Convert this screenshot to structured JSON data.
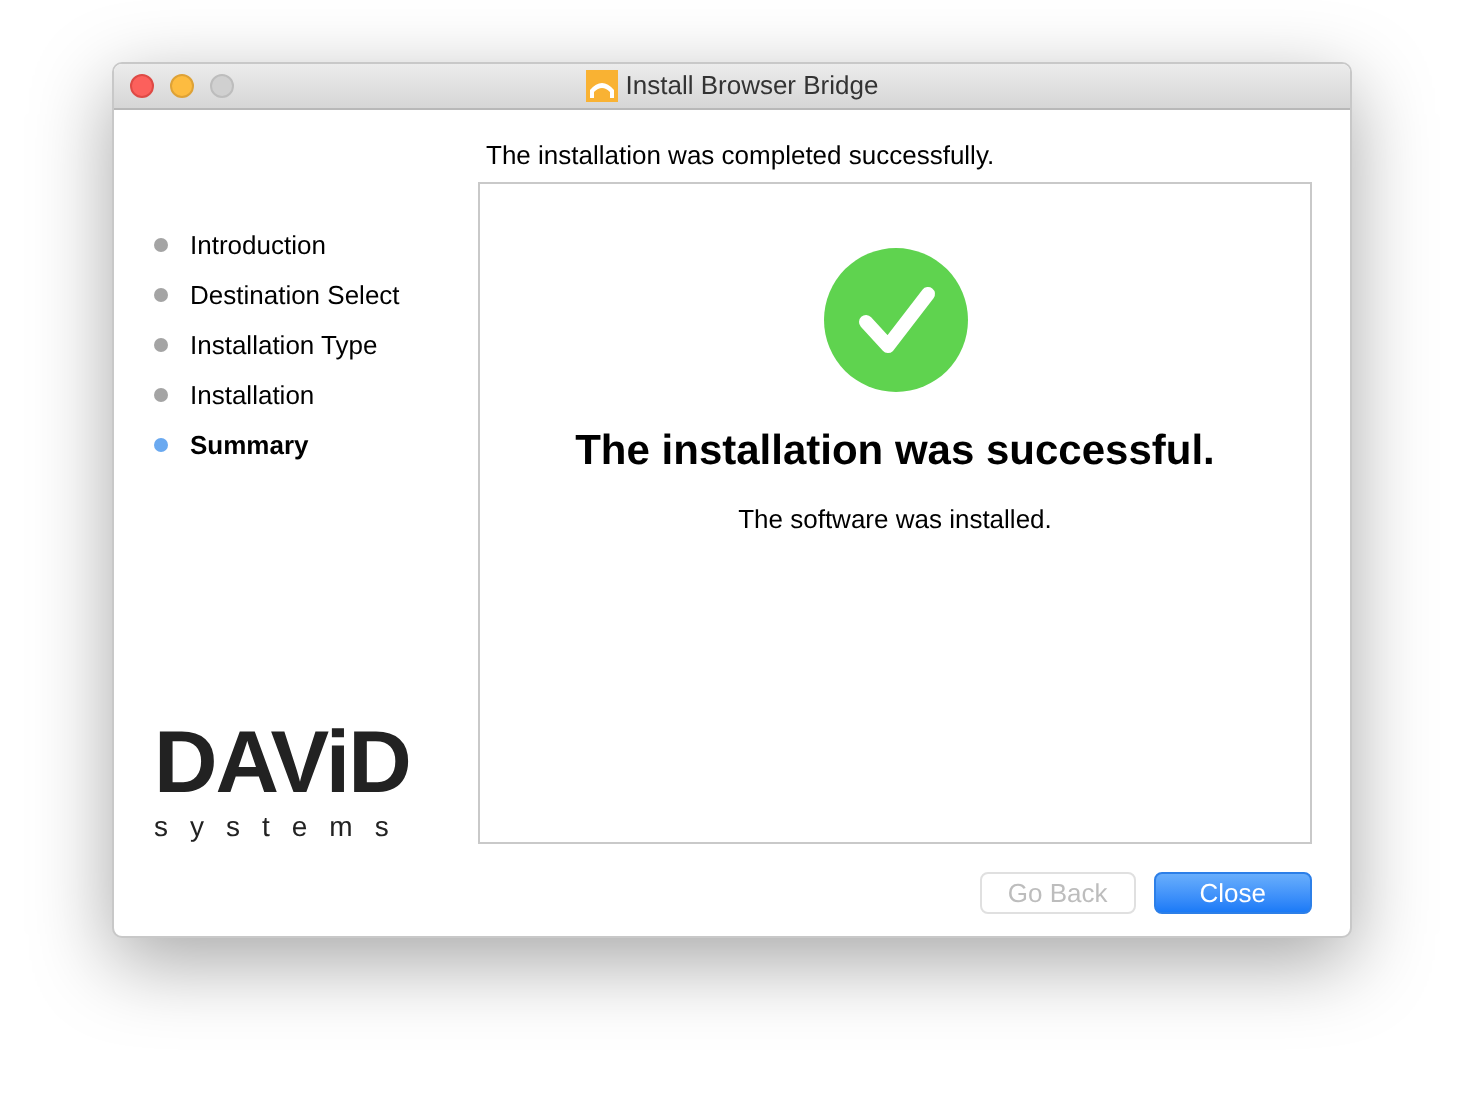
{
  "window": {
    "title": "Install Browser Bridge"
  },
  "heading": "The installation was completed successfully.",
  "steps": [
    {
      "label": "Introduction",
      "selected": false
    },
    {
      "label": "Destination Select",
      "selected": false
    },
    {
      "label": "Installation Type",
      "selected": false
    },
    {
      "label": "Installation",
      "selected": false
    },
    {
      "label": "Summary",
      "selected": true
    }
  ],
  "logo": {
    "name": "DAViD",
    "tagline": "systems"
  },
  "result": {
    "title": "The installation was successful.",
    "message": "The software was installed."
  },
  "buttons": [
    {
      "label": "Go Back",
      "disabled": true,
      "default": false
    },
    {
      "label": "Close",
      "disabled": false,
      "default": true
    }
  ]
}
